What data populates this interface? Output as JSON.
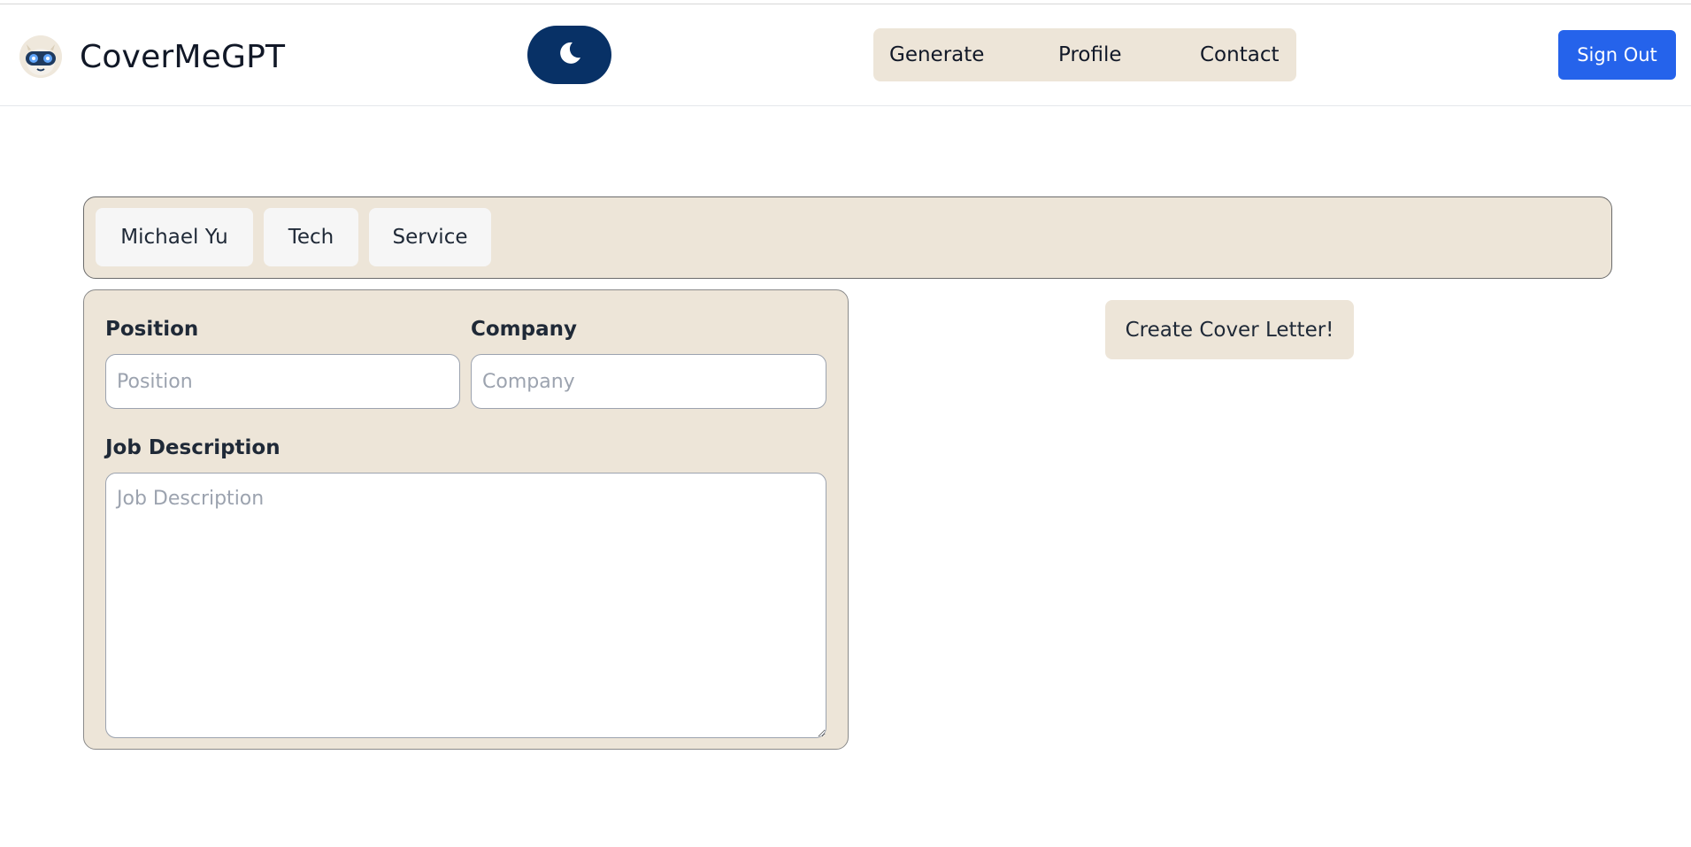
{
  "app": {
    "name": "CoverMeGPT",
    "logo_icon": "robot-avatar-icon"
  },
  "header": {
    "theme_toggle_icon": "moon-icon",
    "theme_toggle_bg": "#083166",
    "nav": [
      {
        "label": "Generate"
      },
      {
        "label": "Profile"
      },
      {
        "label": "Contact"
      }
    ],
    "sign_out_label": "Sign Out",
    "sign_out_color": "#2563eb",
    "nav_bg": "#ede5d8"
  },
  "profile_chips": [
    {
      "label": "Michael Yu"
    },
    {
      "label": "Tech"
    },
    {
      "label": "Service"
    }
  ],
  "form": {
    "position_label": "Position",
    "position_placeholder": "Position",
    "position_value": "",
    "company_label": "Company",
    "company_placeholder": "Company",
    "company_value": "",
    "job_description_label": "Job Description",
    "job_description_placeholder": "Job Description",
    "job_description_value": ""
  },
  "actions": {
    "create_label": "Create Cover Letter!"
  }
}
